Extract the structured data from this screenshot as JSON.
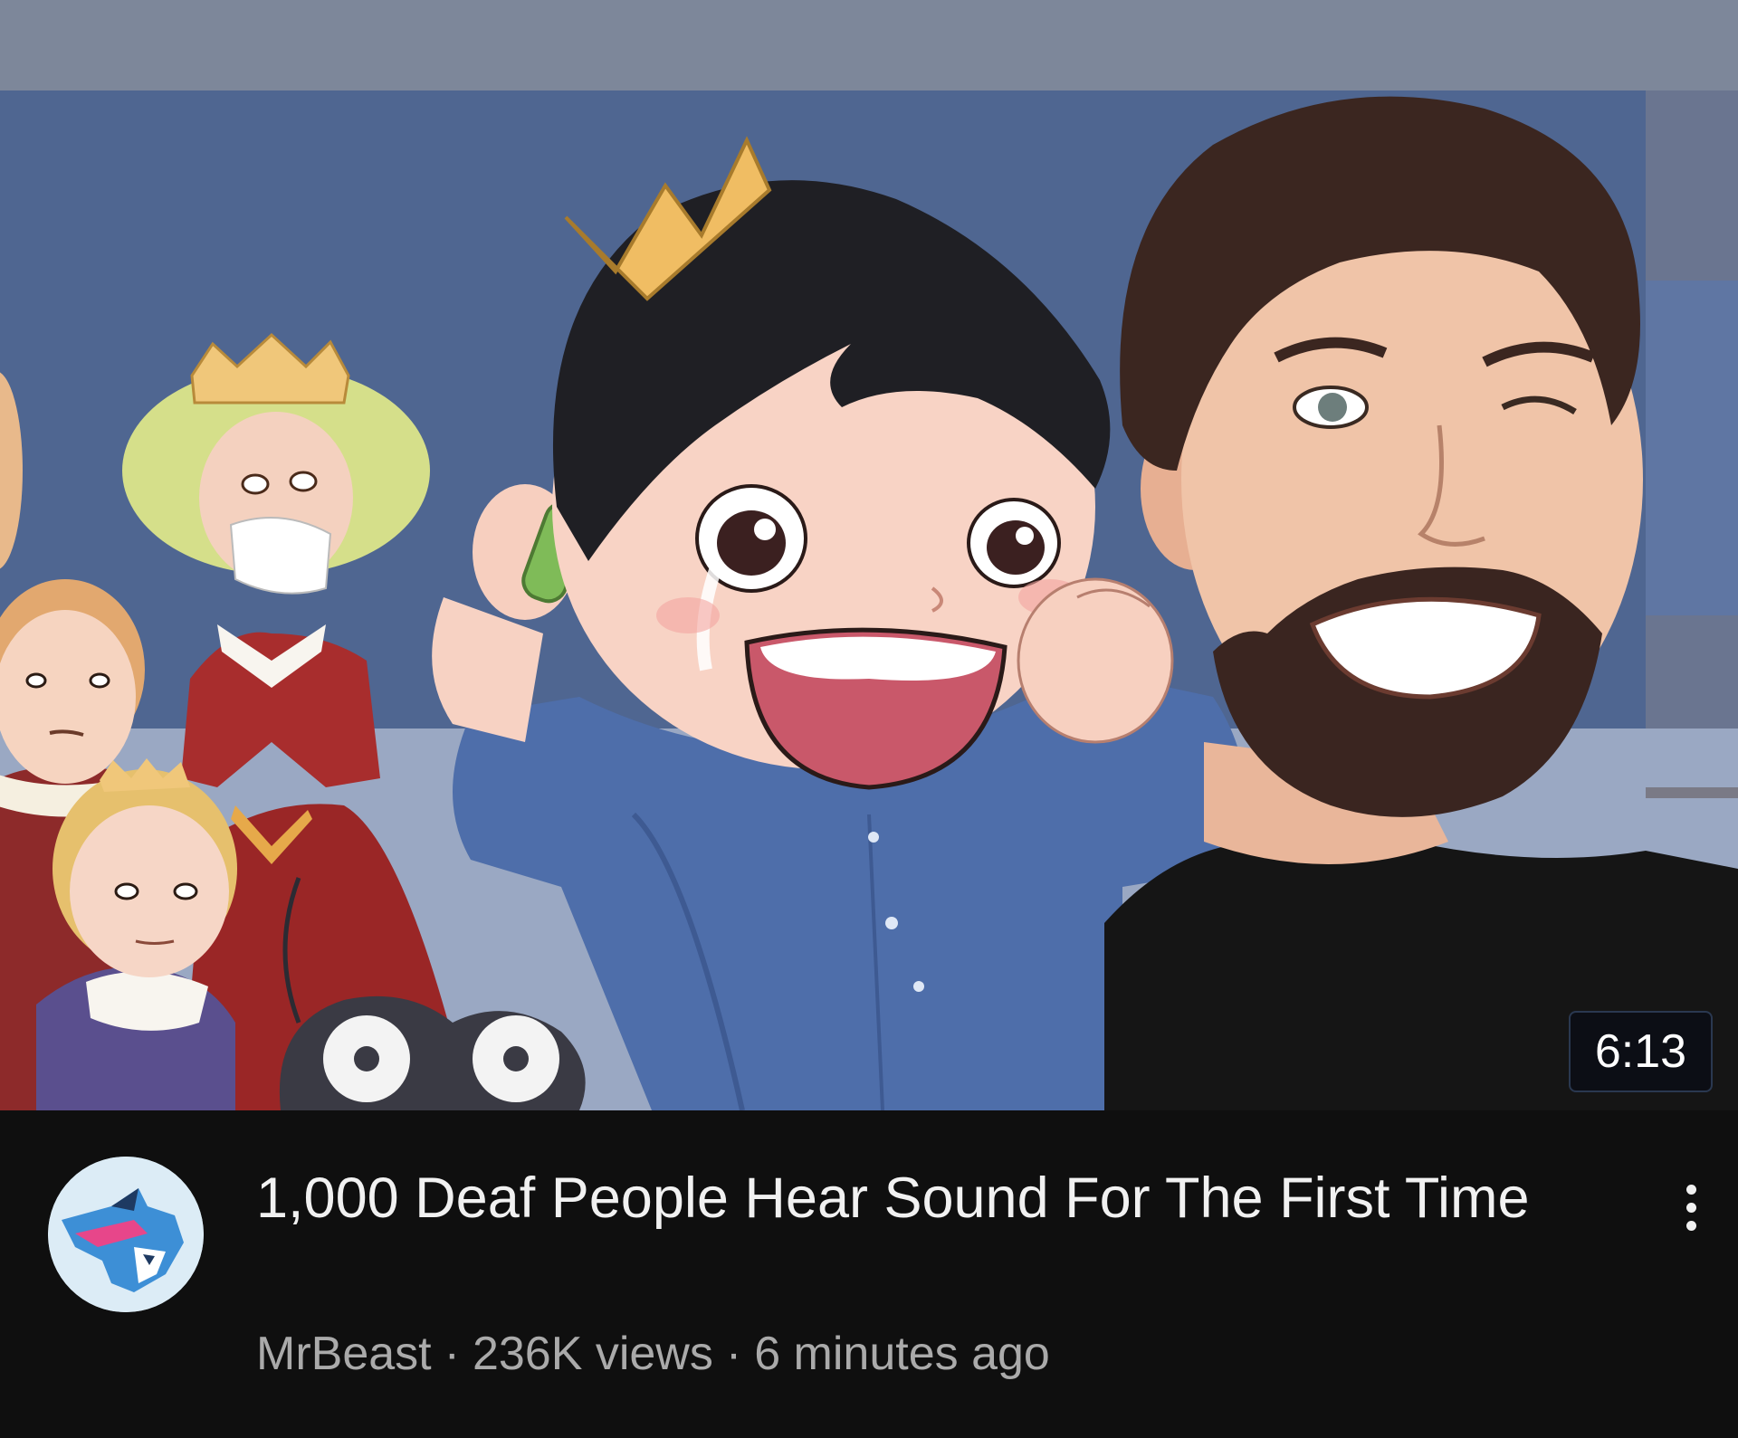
{
  "video": {
    "duration": "6:13",
    "title": "1,000 Deaf People Hear Sound For The First Time",
    "channel": "MrBeast",
    "separator": "·",
    "views": "236K views",
    "age": "6 minutes ago"
  },
  "icons": {
    "menu": "more-vert-icon",
    "avatar": "mrbeast-panther-logo"
  },
  "colors": {
    "background": "#0f0f0f",
    "title_text": "#f1f1f1",
    "meta_text": "#aaaaaa",
    "badge_bg": "#0c0e16"
  }
}
